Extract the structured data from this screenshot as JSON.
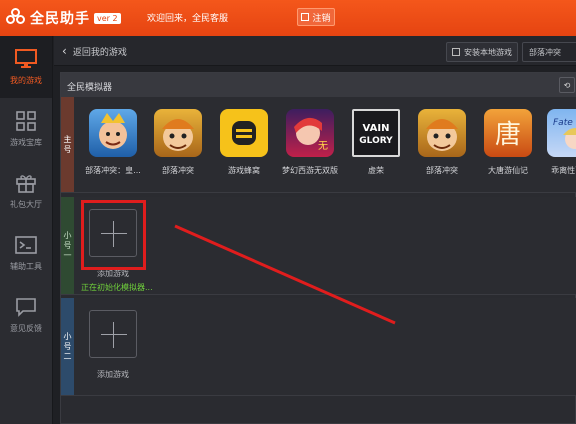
{
  "app": {
    "name": "全民助手",
    "version": "ver 2",
    "welcome": "欢迎回来，全民客服",
    "logout_label": "注销"
  },
  "sidebar": {
    "items": [
      {
        "label": "我的游戏",
        "icon": "monitor-icon",
        "active": true
      },
      {
        "label": "游戏宝库",
        "icon": "grid-icon",
        "active": false
      },
      {
        "label": "礼包大厅",
        "icon": "gift-icon",
        "active": false
      },
      {
        "label": "辅助工具",
        "icon": "terminal-icon",
        "active": false
      },
      {
        "label": "意见反馈",
        "icon": "chat-icon",
        "active": false
      }
    ]
  },
  "header": {
    "back_label": "返回我的游戏",
    "install_label": "安装本地游戏",
    "search_value": "部落冲突"
  },
  "panel": {
    "title": "全民模拟器",
    "groups": [
      {
        "label": "主号",
        "games": [
          {
            "name": "部落冲突：皇...",
            "icon": "clash-royale-icon"
          },
          {
            "name": "部落冲突",
            "icon": "clash-of-clans-icon"
          },
          {
            "name": "游戏蜂窝",
            "icon": "bee-icon"
          },
          {
            "name": "梦幻西游无双版",
            "icon": "dream-west-icon"
          },
          {
            "name": "虚荣",
            "icon": "vainglory-icon"
          },
          {
            "name": "部落冲突",
            "icon": "clash-of-clans-icon"
          },
          {
            "name": "大唐游仙记",
            "icon": "datang-icon"
          },
          {
            "name": "乖离性百...",
            "icon": "fate-icon"
          }
        ]
      },
      {
        "label": "小号一",
        "add_label": "添加游戏",
        "status": "正在初始化模拟器..."
      },
      {
        "label": "小号二",
        "add_label": "添加游戏"
      }
    ]
  },
  "colors": {
    "accent": "#f05a22",
    "highlight": "#e01d1d",
    "status_green": "#6fcf3b"
  }
}
